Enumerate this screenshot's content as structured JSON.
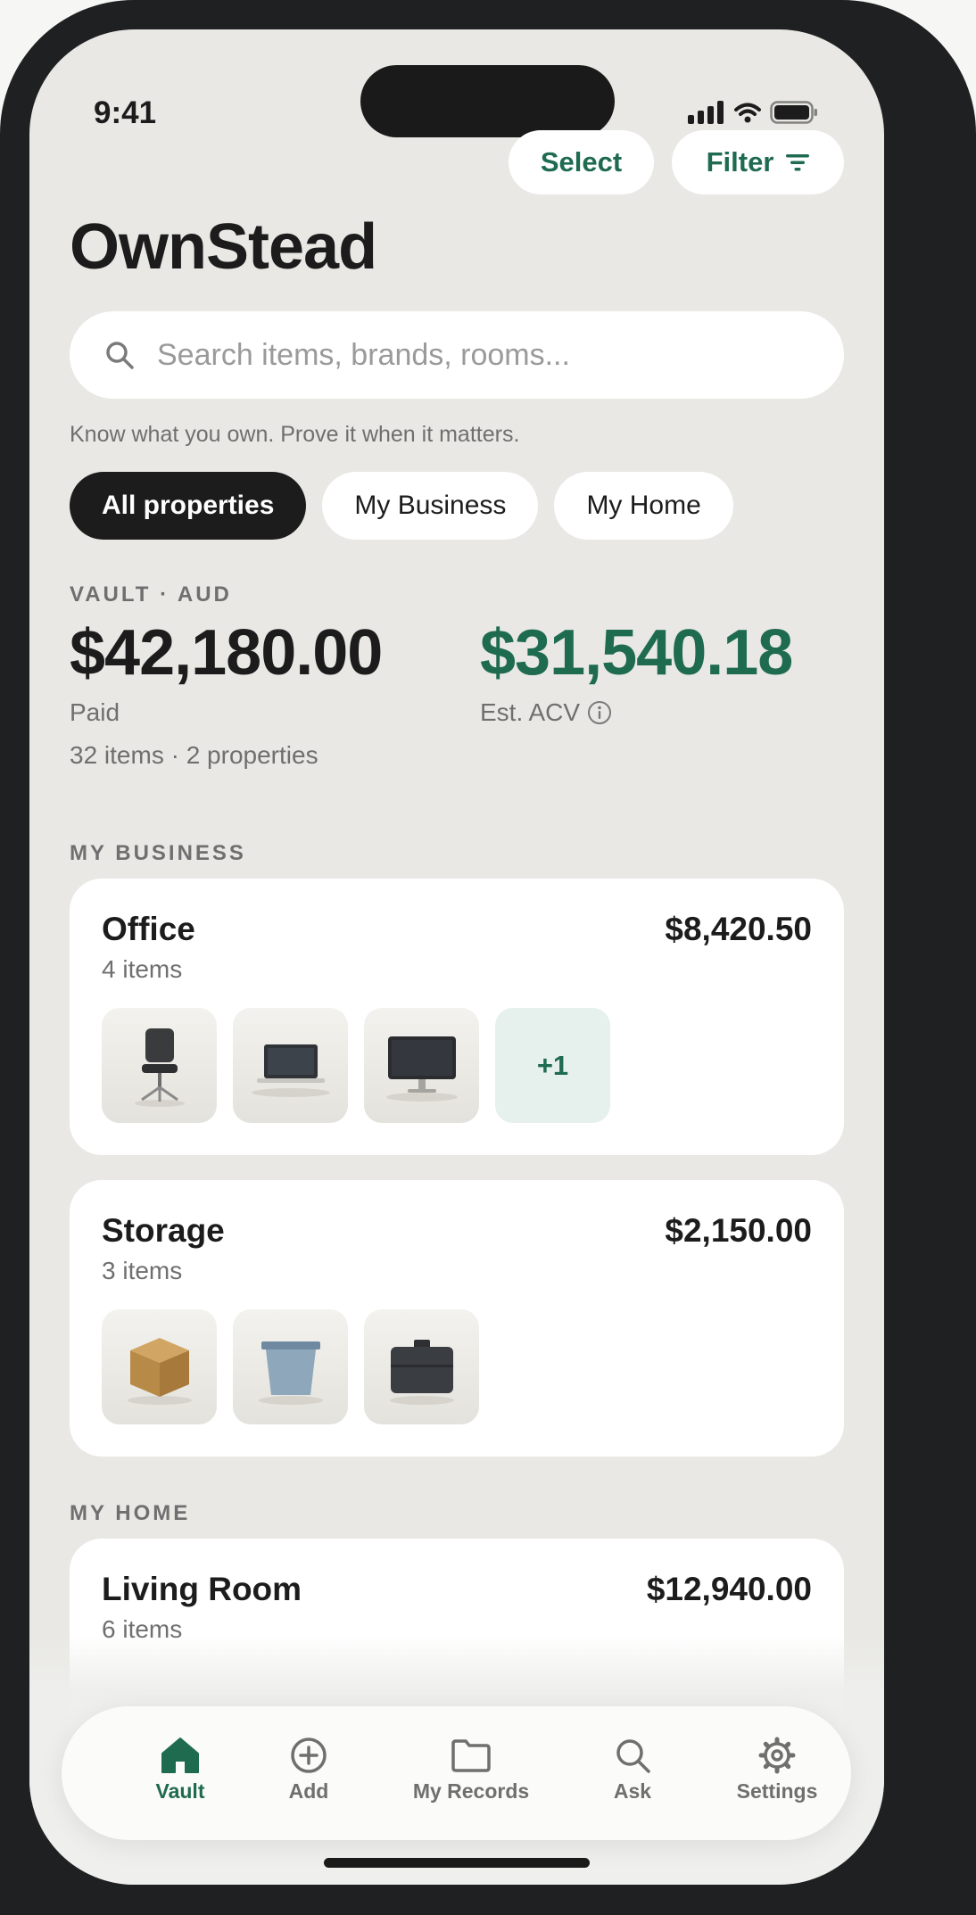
{
  "status_bar": {
    "time": "9:41"
  },
  "header": {
    "select_label": "Select",
    "filter_label": "Filter",
    "app_title": "OwnStead"
  },
  "search": {
    "placeholder": "Search items, brands, rooms..."
  },
  "tagline": "Know what you own. Prove it when it matters.",
  "property_filters": [
    "All properties",
    "My Business",
    "My Home"
  ],
  "property_filter_selected": "All properties",
  "vault": {
    "label": "VAULT · AUD",
    "paid_value": "$42,180.00",
    "paid_label": "Paid",
    "acv_value": "$31,540.18",
    "acv_label": "Est. ACV",
    "summary": "32 items · 2 properties"
  },
  "sections": [
    {
      "title": "MY BUSINESS",
      "rooms": [
        {
          "name": "Office",
          "count": "4 items",
          "value": "$8,420.50",
          "thumbs": [
            "office-chair-icon",
            "laptop-icon",
            "monitor-icon"
          ],
          "more": "+1"
        },
        {
          "name": "Storage",
          "count": "3 items",
          "value": "$2,150.00",
          "thumbs": [
            "cardboard-box-icon",
            "storage-bin-icon",
            "toolbox-icon"
          ]
        }
      ]
    },
    {
      "title": "MY HOME",
      "rooms": [
        {
          "name": "Living Room",
          "count": "6 items",
          "value": "$12,940.00"
        }
      ]
    }
  ],
  "tabbar": {
    "items": [
      {
        "label": "Vault",
        "icon": "home-icon"
      },
      {
        "label": "Add",
        "icon": "plus-circle-icon"
      },
      {
        "label": "My Records",
        "icon": "folder-icon"
      },
      {
        "label": "Ask",
        "icon": "search-icon"
      },
      {
        "label": "Settings",
        "icon": "gear-icon"
      }
    ],
    "active": "Vault"
  },
  "colors": {
    "accent": "#1e6b50",
    "background": "#e9e8e4",
    "dark": "#1c1c1c",
    "muted": "#6f6f6f"
  }
}
